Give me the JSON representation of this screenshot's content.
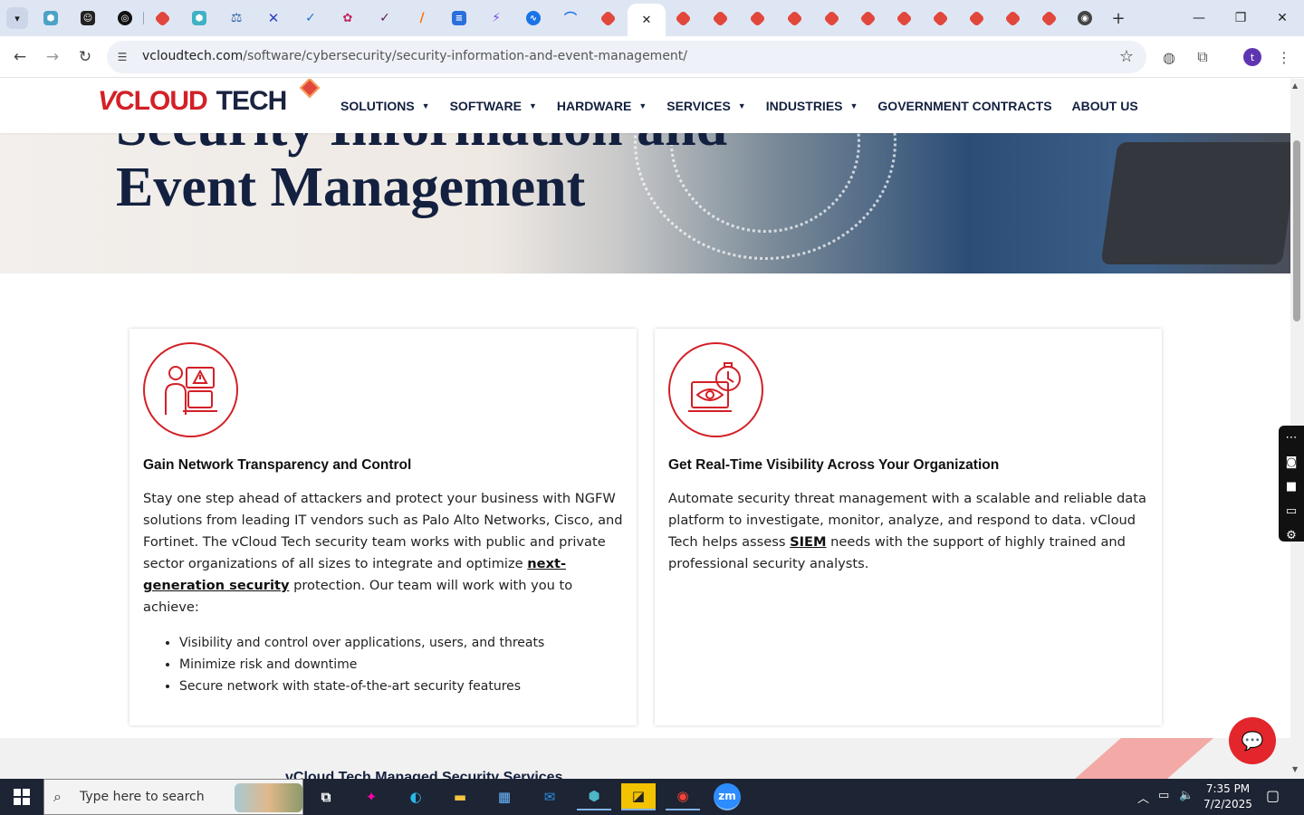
{
  "browser": {
    "tabs_count_hint": "many",
    "active_tab_close": "✕",
    "new_tab": "+",
    "url_domain": "vcloudtech.com",
    "url_path": "/software/cybersecurity/security-information-and-event-management/",
    "profile_initial": "t"
  },
  "site": {
    "logo_v": "V",
    "logo_cloud": "CLOUD",
    "logo_tech": "TECH",
    "menu": [
      {
        "label": "SOLUTIONS",
        "caret": true
      },
      {
        "label": "SOFTWARE",
        "caret": true
      },
      {
        "label": "HARDWARE",
        "caret": true
      },
      {
        "label": "SERVICES",
        "caret": true
      },
      {
        "label": "INDUSTRIES",
        "caret": true
      },
      {
        "label": "GOVERNMENT CONTRACTS",
        "caret": false
      },
      {
        "label": "ABOUT US",
        "caret": false
      }
    ],
    "hero_title_line1": "Security Information and",
    "hero_title_line2": "Event Management",
    "cards": [
      {
        "title": "Gain Network Transparency and Control",
        "text_before": "Stay one step ahead of attackers and protect your business with NGFW solutions from leading IT vendors such as Palo Alto Networks, Cisco, and Fortinet. The vCloud Tech security team works with public and private sector organizations of all sizes to integrate and optimize ",
        "link": "next-generation security",
        "text_after": " protection. Our team will work with you to achieve:",
        "bullets": [
          "Visibility and control over applications, users, and threats",
          "Minimize risk and downtime",
          "Secure network with state-of-the-art security features"
        ]
      },
      {
        "title": "Get Real-Time Visibility Across Your Organization",
        "text_before": "Automate security threat management with a scalable and reliable data platform to investigate, monitor, analyze, and respond to data. vCloud Tech helps assess ",
        "link": "SIEM",
        "text_after": " needs with the support of highly trained and professional security analysts."
      }
    ],
    "band_subtitle": "vCloud Tech Managed Security Services"
  },
  "taskbar": {
    "search_placeholder": "Type here to search",
    "time": "7:35 PM",
    "date": "7/2/2025"
  },
  "colors": {
    "brand_red": "#d32027",
    "navy": "#13203f"
  }
}
